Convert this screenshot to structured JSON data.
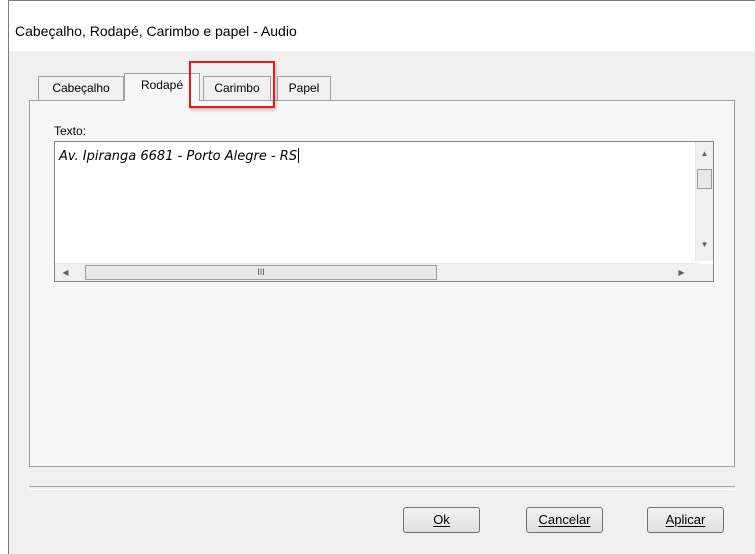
{
  "window": {
    "title": "Cabeçalho, Rodapé, Carimbo e papel - Audio"
  },
  "tabs": [
    {
      "label": "Cabeçalho",
      "active": false
    },
    {
      "label": "Rodapé",
      "active": true
    },
    {
      "label": "Carimbo",
      "active": false,
      "highlighted": true
    },
    {
      "label": "Papel",
      "active": false
    }
  ],
  "texto": {
    "label": "Texto:",
    "value": "Av. Ipiranga 6681 - Porto Alegre - RS"
  },
  "scroll": {
    "hthumb_grip": "III"
  },
  "buttons": {
    "ok": "Ok",
    "cancel": "Cancelar",
    "apply": "Aplicar"
  },
  "colors": {
    "highlight": "#e21b1b",
    "dialog_bg": "#f0f0f0"
  }
}
